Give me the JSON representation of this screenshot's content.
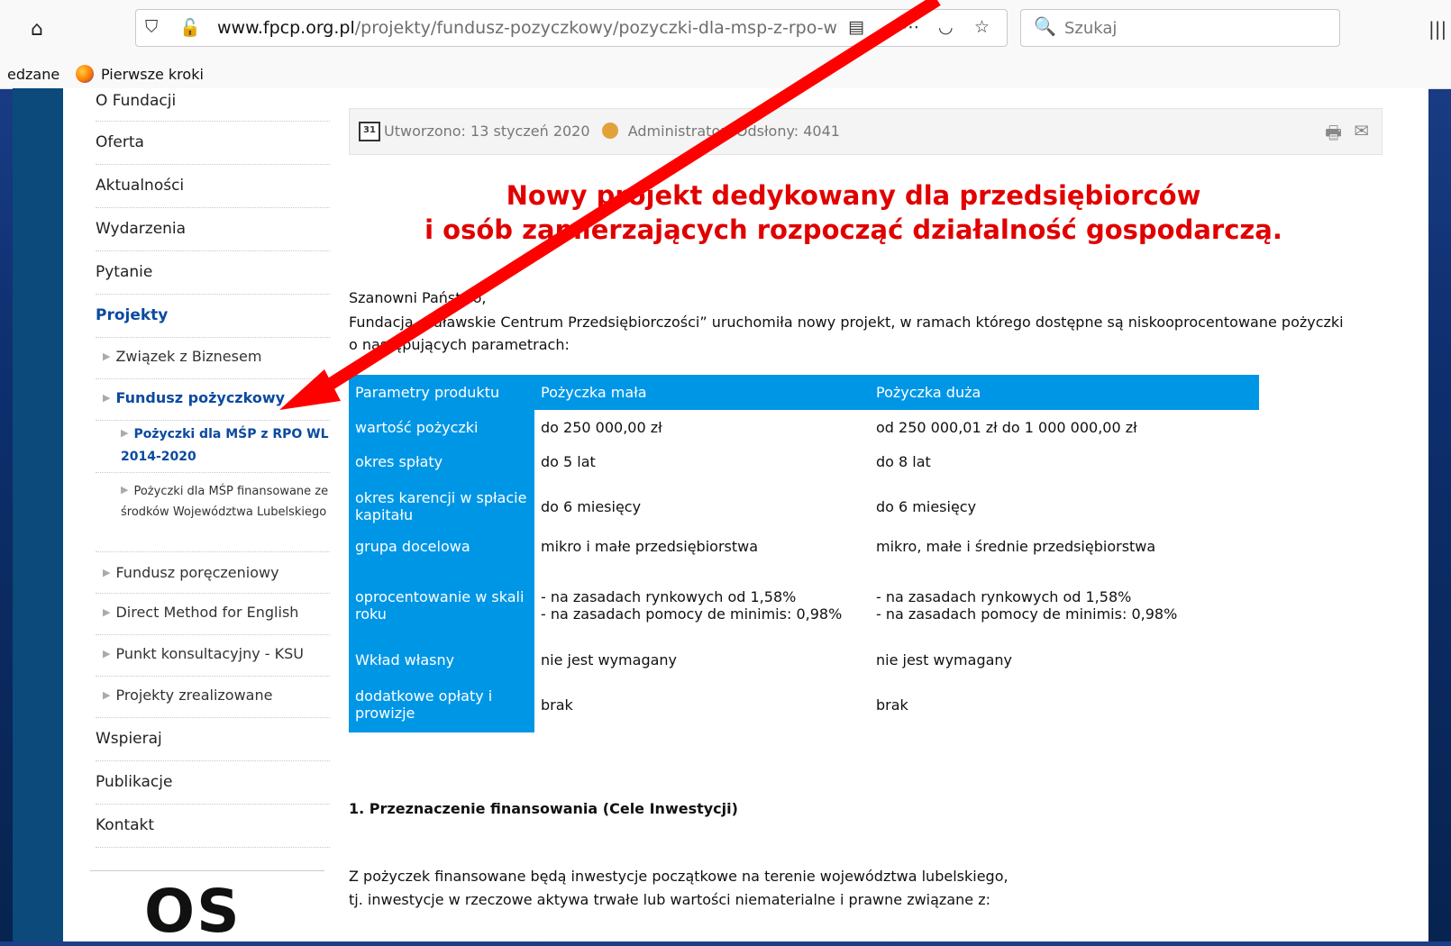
{
  "browser": {
    "url_domain": "www.fpcp.org.pl",
    "url_path": "/projekty/fundusz-pozyczkowy/pozyczki-dla-msp-z-rpo-wl",
    "search_placeholder": "Szukaj",
    "bookmarks": [
      "edzane",
      "Pierwsze kroki"
    ]
  },
  "sidebar": {
    "items": [
      {
        "label": "O Fundacji"
      },
      {
        "label": "Oferta"
      },
      {
        "label": "Aktualności"
      },
      {
        "label": "Wydarzenia"
      },
      {
        "label": "Pytanie"
      },
      {
        "label": "Projekty"
      }
    ],
    "sub_items": [
      {
        "label": "Związek z Biznesem"
      },
      {
        "label": "Fundusz pożyczkowy"
      }
    ],
    "sub_sub_items": [
      {
        "label": "Pożyczki dla MŚP z RPO WL 2014-2020"
      },
      {
        "label": "Pożyczki dla MŚP finansowane ze środków Województwa Lubelskiego"
      }
    ],
    "sub_items_2": [
      {
        "label": "Fundusz poręczeniowy"
      },
      {
        "label": "Direct Method for English"
      },
      {
        "label": "Punkt konsultacyjny - KSU"
      },
      {
        "label": "Projekty zrealizowane"
      }
    ],
    "bottom_items": [
      {
        "label": "Wspieraj"
      },
      {
        "label": "Publikacje"
      },
      {
        "label": "Kontakt"
      }
    ],
    "logo_text": "OS"
  },
  "article": {
    "created": "Utworzono: 13 styczeń 2020",
    "author": "Administrator",
    "views": "Odsłony: 4041",
    "headline_1": "Nowy projekt dedykowany dla przedsiębiorców",
    "headline_2": "i osób zamierzających rozpocząć działalność gospodarczą.",
    "greeting": "Szanowni Państwo,",
    "intro": "Fundacja „Puławskie Centrum Przedsiębiorczości” uruchomiła nowy projekt, w ramach którego dostępne są niskooprocentowane pożyczki o następujących parametrach:",
    "table": {
      "headers": [
        "Parametry produktu",
        "Pożyczka mała",
        "Pożyczka duża"
      ],
      "rows": [
        {
          "param": "wartość pożyczki",
          "small": "do 250 000,00 zł",
          "large": "od 250 000,01 zł do 1 000 000,00 zł"
        },
        {
          "param": "okres spłaty",
          "small": "do 5 lat",
          "large": "do 8 lat"
        },
        {
          "param": "okres karencji w spłacie kapitału",
          "small": "do 6 miesięcy",
          "large": "do 6 miesięcy"
        },
        {
          "param": "grupa docelowa",
          "small": "mikro i małe przedsiębiorstwa",
          "large": "mikro, małe i średnie przedsiębiorstwa"
        },
        {
          "param": "oprocentowanie w skali roku",
          "small": "- na zasadach rynkowych od 1,58%\n- na zasadach pomocy de minimis: 0,98%",
          "large": "- na zasadach rynkowych od 1,58%\n- na zasadach pomocy de minimis: 0,98%"
        },
        {
          "param": "Wkład własny",
          "small": "nie jest wymagany",
          "large": "nie jest wymagany"
        },
        {
          "param": "dodatkowe opłaty i prowizje",
          "small": "brak",
          "large": "brak"
        }
      ]
    },
    "section_title": "1. Przeznaczenie finansowania (Cele Inwestycji)",
    "body_1": "Z pożyczek finansowane będą inwestycje początkowe na terenie województwa lubelskiego,",
    "body_2": "tj. inwestycje w rzeczowe aktywa trwałe lub wartości niematerialne i prawne związane z:"
  },
  "colors": {
    "accent_red": "#e10000",
    "table_blue": "#0096e6",
    "nav_active": "#0b4aa0",
    "annotation_arrow": "#ff0000"
  }
}
